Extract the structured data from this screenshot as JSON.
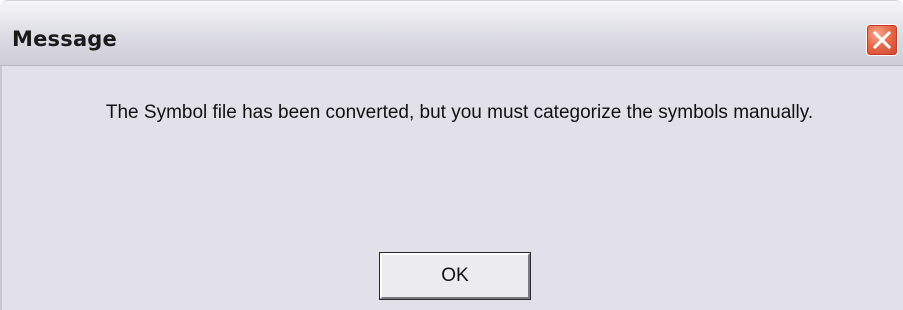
{
  "window": {
    "title": "Message",
    "close_icon": "close-x-icon"
  },
  "content": {
    "message": "The Symbol file has been converted, but you must categorize the symbols manually."
  },
  "buttons": {
    "ok_label": "OK"
  },
  "colors": {
    "dialog_background": "#e2e1e9",
    "close_button": "#e8694a"
  }
}
